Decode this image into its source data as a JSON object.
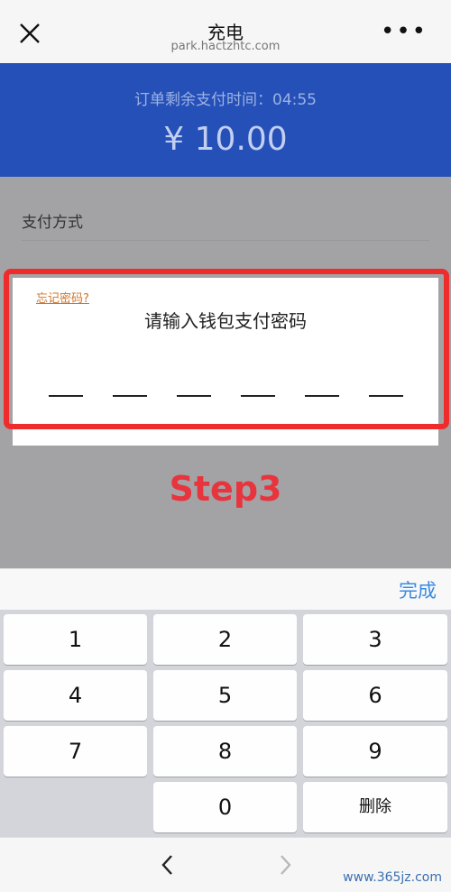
{
  "nav": {
    "title": "充电",
    "url": "park.hactzhtc.com",
    "more": "•••"
  },
  "payment": {
    "timer": "订单剩余支付时间：04:55",
    "amount": "¥ 10.00"
  },
  "pay_method_label": "支付方式",
  "dialog": {
    "forgot": "忘记密码?",
    "prompt": "请输入钱包支付密码"
  },
  "annotation": "Step3",
  "keyboard": {
    "done": "完成",
    "keys": [
      "1",
      "2",
      "3",
      "4",
      "5",
      "6",
      "7",
      "8",
      "9",
      "0",
      "删除"
    ]
  },
  "watermark": "www.365jz.com",
  "colors": {
    "header_blue": "#2550b8",
    "annotation_red": "#e8343d",
    "done_blue": "#3a8be0",
    "forgot_orange": "#d0752a"
  }
}
